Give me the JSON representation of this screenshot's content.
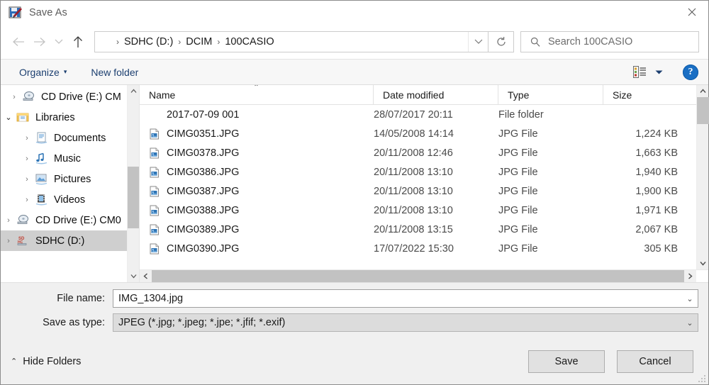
{
  "window": {
    "title": "Save As",
    "title_icon": "paint-save-icon",
    "close_label": "✕"
  },
  "navigation": {
    "back_icon": "arrow-left-icon",
    "forward_icon": "arrow-right-icon",
    "recent_icon": "chevron-down-icon",
    "up_icon": "arrow-up-icon",
    "refresh_icon": "refresh-icon",
    "breadcrumb": [
      "SDHC (D:)",
      "DCIM",
      "100CASIO"
    ],
    "separator": "›",
    "dropdown_icon": "chevron-down-icon"
  },
  "search": {
    "placeholder": "Search 100CASIO",
    "icon": "search-icon"
  },
  "toolbar": {
    "organize_label": "Organize",
    "organize_caret": "▾",
    "new_folder_label": "New folder",
    "view_icon": "view-details-icon",
    "view_caret": "▼",
    "help_label": "?",
    "help_icon": "help-icon"
  },
  "sidebar": {
    "items": [
      {
        "label": "CD Drive (E:) CM",
        "icon": "cd-drive-icon",
        "indent": 1,
        "chevron": "›",
        "expanded": false,
        "selected": false
      },
      {
        "label": "Libraries",
        "icon": "libraries-icon",
        "indent": 0,
        "chevron": "⌄",
        "expanded": true,
        "selected": false
      },
      {
        "label": "Documents",
        "icon": "documents-icon",
        "indent": 2,
        "chevron": "›",
        "expanded": false,
        "selected": false
      },
      {
        "label": "Music",
        "icon": "music-icon",
        "indent": 2,
        "chevron": "›",
        "expanded": false,
        "selected": false
      },
      {
        "label": "Pictures",
        "icon": "pictures-icon",
        "indent": 2,
        "chevron": "›",
        "expanded": false,
        "selected": false
      },
      {
        "label": "Videos",
        "icon": "videos-icon",
        "indent": 2,
        "chevron": "›",
        "expanded": false,
        "selected": false
      },
      {
        "label": "CD Drive (E:) CM0",
        "icon": "cd-drive-icon",
        "indent": 0,
        "chevron": "›",
        "expanded": false,
        "selected": false
      },
      {
        "label": "SDHC (D:)",
        "icon": "sd-card-icon",
        "indent": 0,
        "chevron": "›",
        "expanded": false,
        "selected": true
      }
    ],
    "scroll_up_icon": "chevron-up-icon",
    "scroll_down_icon": "chevron-down-icon"
  },
  "filelist": {
    "columns": [
      "Name",
      "Date modified",
      "Type",
      "Size"
    ],
    "sort_column": "Name",
    "sort_indicator": "⌃",
    "rows": [
      {
        "name": "2017-07-09 001",
        "date": "28/07/2017 20:11",
        "type": "File folder",
        "size": "",
        "icon": "folder-icon"
      },
      {
        "name": "CIMG0351.JPG",
        "date": "14/05/2008 14:14",
        "type": "JPG File",
        "size": "1,224 KB",
        "icon": "jpg-file-icon"
      },
      {
        "name": "CIMG0378.JPG",
        "date": "20/11/2008 12:46",
        "type": "JPG File",
        "size": "1,663 KB",
        "icon": "jpg-file-icon"
      },
      {
        "name": "CIMG0386.JPG",
        "date": "20/11/2008 13:10",
        "type": "JPG File",
        "size": "1,940 KB",
        "icon": "jpg-file-icon"
      },
      {
        "name": "CIMG0387.JPG",
        "date": "20/11/2008 13:10",
        "type": "JPG File",
        "size": "1,900 KB",
        "icon": "jpg-file-icon"
      },
      {
        "name": "CIMG0388.JPG",
        "date": "20/11/2008 13:10",
        "type": "JPG File",
        "size": "1,971 KB",
        "icon": "jpg-file-icon"
      },
      {
        "name": "CIMG0389.JPG",
        "date": "20/11/2008 13:15",
        "type": "JPG File",
        "size": "2,067 KB",
        "icon": "jpg-file-icon"
      },
      {
        "name": "CIMG0390.JPG",
        "date": "17/07/2022 15:30",
        "type": "JPG File",
        "size": "305 KB",
        "icon": "jpg-file-icon"
      }
    ],
    "scroll_up_icon": "chevron-up-icon",
    "scroll_down_icon": "chevron-down-icon",
    "scroll_left_icon": "chevron-left-icon",
    "scroll_right_icon": "chevron-right-icon"
  },
  "form": {
    "filename_label": "File name:",
    "filename_value": "IMG_1304.jpg",
    "filetype_label": "Save as type:",
    "filetype_value": "JPEG (*.jpg; *.jpeg; *.jpe; *.jfif; *.exif)",
    "caret": "⌄"
  },
  "footer": {
    "hide_folders_label": "Hide Folders",
    "hide_folders_chevron": "⌃",
    "save_label": "Save",
    "cancel_label": "Cancel"
  },
  "colors": {
    "accent": "#1a6fc4",
    "toolbar_link": "#1c3f70",
    "folder": "#f3c658",
    "selection": "#cfcfcf",
    "chrome": "#f0f0f0"
  }
}
